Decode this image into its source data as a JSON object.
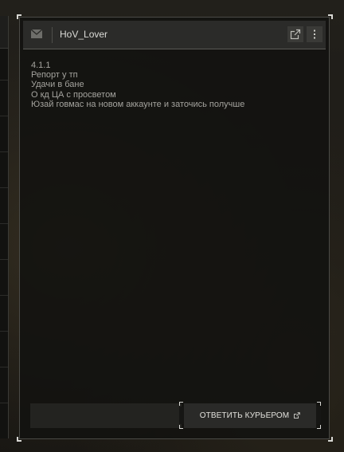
{
  "message": {
    "sender": "HoV_Lover",
    "lines": [
      "4.1.1",
      "Репорт у тп",
      "Удачи в бане",
      "О кд ЦА с просветом",
      "Юзай говмас на новом аккаунте и заточись получше"
    ]
  },
  "actions": {
    "reply_label": "ОТВЕТИТЬ КУРЬЕРОМ"
  },
  "icons": {
    "header_left": "mail-icon",
    "header_popout": "external-link-icon",
    "header_menu": "more-vertical-icon",
    "reply": "external-link-icon"
  }
}
